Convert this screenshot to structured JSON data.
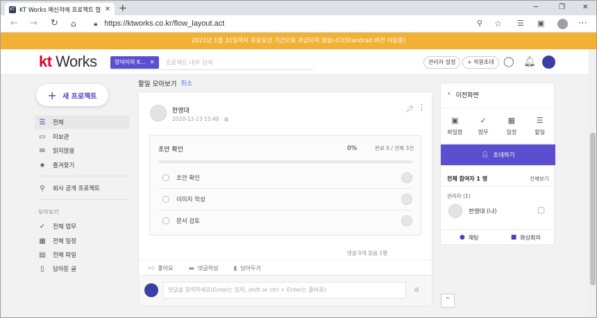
{
  "browser": {
    "tab_title": "KT Works 메신저에 프로젝트 협",
    "tab_close": "✕",
    "new_tab": "+",
    "url": "https://ktworks.co.kr/flow_layout.act",
    "favicon_text": "KT"
  },
  "banner": {
    "text": "2021년 1월 31일까지 프로모션 기간으로 과금되지 않습니다(Standrad 버전 이용중)",
    "color": "#f2b035"
  },
  "header": {
    "logo_kt": "kt",
    "logo_works": " Works",
    "chip_label": "영덕이의 K...",
    "chip_close": "✕",
    "search_placeholder": "프로젝트 내부 검색",
    "admin_settings": "관리자 설정",
    "invite_staff": "+ 직원초대"
  },
  "sidebar": {
    "new_project": "새 프로젝트",
    "items": [
      {
        "label": "전체",
        "icon": "menu-icon"
      },
      {
        "label": "미보관",
        "icon": "inbox-icon"
      },
      {
        "label": "읽지않음",
        "icon": "envelope-icon"
      },
      {
        "label": "즐겨찾기",
        "icon": "star-icon"
      }
    ],
    "public_projects": "회사 공개 프로젝트",
    "section_title": "모아보기",
    "collection": [
      {
        "label": "전체 업무",
        "icon": "check-icon"
      },
      {
        "label": "전체 일정",
        "icon": "calendar-icon"
      },
      {
        "label": "전체 파일",
        "icon": "file-icon"
      },
      {
        "label": "담아둔 글",
        "icon": "bookmark-icon"
      }
    ]
  },
  "main": {
    "title": "할일 모아보기",
    "cancel": "취소",
    "post": {
      "author": "한영대",
      "date": "2020-12-23 15:40",
      "task": {
        "title": "초안 확인",
        "percent": "0%",
        "progress": 0,
        "count": "완료 0 / 전체 3건",
        "items": [
          "초안 확인",
          "이미지 작성",
          "문서 검토"
        ]
      },
      "comments_meta": "댓글 0개  읽음 1명",
      "actions": {
        "like": "좋아요",
        "comment": "댓글작성",
        "save": "담아두기"
      }
    },
    "comment_placeholder": "댓글을 입력하세요(Enter는 입력, shift or ctrl + Enter는 줄바꿈)"
  },
  "right_panel": {
    "back": "이전화면",
    "tabs": [
      {
        "label": "파일함",
        "icon": "folder-icon"
      },
      {
        "label": "업무",
        "icon": "check-icon"
      },
      {
        "label": "일정",
        "icon": "calendar-icon"
      },
      {
        "label": "할일",
        "icon": "list-icon"
      }
    ],
    "invite": "초대하기",
    "members": "전체 참여자 1 명",
    "view_all": "전체보기",
    "admin_label": "관리자 (1)",
    "member_name": "한영대 (나)",
    "chat": "채팅",
    "video": "화상회의",
    "accent": "#5b4fcf"
  }
}
